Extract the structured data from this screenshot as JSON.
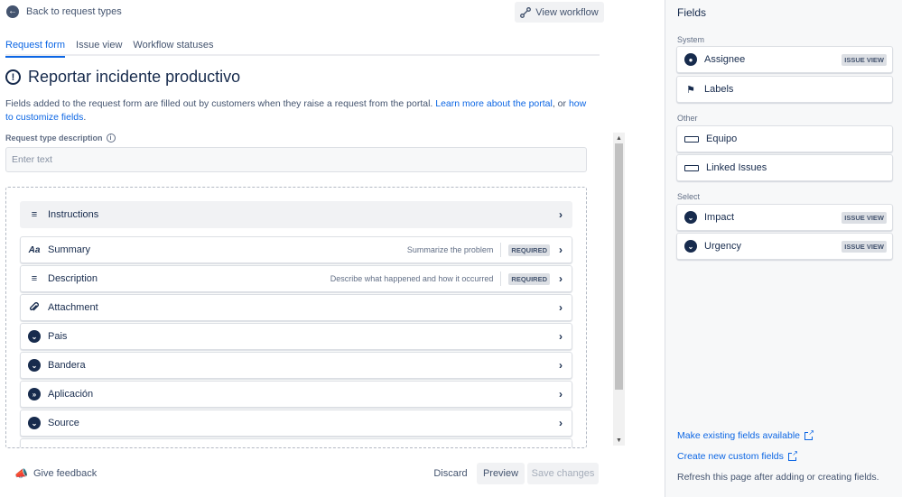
{
  "header": {
    "back_label": "Back to request types",
    "view_workflow_label": "View workflow"
  },
  "tabs": [
    {
      "label": "Request form",
      "active": true
    },
    {
      "label": "Issue view",
      "active": false
    },
    {
      "label": "Workflow statuses",
      "active": false
    }
  ],
  "page": {
    "title": "Reportar incidente productivo",
    "intro_text": "Fields added to the request form are filled out by customers when they raise a request from the portal.",
    "intro_link1": "Learn more about the portal",
    "intro_or": ", or",
    "intro_link2": "how to customize fields",
    "intro_end": ".",
    "description_label": "Request type description",
    "description_placeholder": "Enter text"
  },
  "fields": [
    {
      "label": "Instructions",
      "icon": "lines-icon",
      "hint": "",
      "badge": ""
    },
    {
      "label": "Summary",
      "icon": "text-aa-icon",
      "hint": "Summarize the problem",
      "badge": "REQUIRED"
    },
    {
      "label": "Description",
      "icon": "lines-icon",
      "hint": "Describe what happened and how it occurred",
      "badge": "REQUIRED"
    },
    {
      "label": "Attachment",
      "icon": "paperclip-icon",
      "hint": "",
      "badge": ""
    },
    {
      "label": "Pais",
      "icon": "chevron-circle-icon",
      "hint": "",
      "badge": ""
    },
    {
      "label": "Bandera",
      "icon": "chevron-circle-icon",
      "hint": "",
      "badge": ""
    },
    {
      "label": "Aplicación",
      "icon": "double-chevron-circle-icon",
      "hint": "",
      "badge": ""
    },
    {
      "label": "Source",
      "icon": "chevron-circle-icon",
      "hint": "",
      "badge": ""
    }
  ],
  "footer": {
    "feedback_label": "Give feedback",
    "discard_label": "Discard",
    "preview_label": "Preview",
    "save_label": "Save changes"
  },
  "sidebar": {
    "title": "Fields",
    "sections": [
      {
        "name": "System",
        "items": [
          {
            "label": "Assignee",
            "icon": "user-icon",
            "badge": "ISSUE VIEW"
          },
          {
            "label": "Labels",
            "icon": "tag-icon",
            "badge": ""
          }
        ]
      },
      {
        "name": "Other",
        "items": [
          {
            "label": "Equipo",
            "icon": "text-field-icon",
            "badge": ""
          },
          {
            "label": "Linked Issues",
            "icon": "text-field-icon",
            "badge": ""
          }
        ]
      },
      {
        "name": "Select",
        "items": [
          {
            "label": "Impact",
            "icon": "chevron-circle-icon",
            "badge": "ISSUE VIEW"
          },
          {
            "label": "Urgency",
            "icon": "chevron-circle-icon",
            "badge": "ISSUE VIEW"
          }
        ]
      }
    ],
    "link_existing": "Make existing fields available",
    "link_new": "Create new custom fields",
    "note": "Refresh this page after adding or creating fields."
  },
  "colors": {
    "accent": "#0c66e4",
    "text": "#172b4d",
    "subtle": "#44546f",
    "sidebar_bg": "#f7f8f9"
  }
}
